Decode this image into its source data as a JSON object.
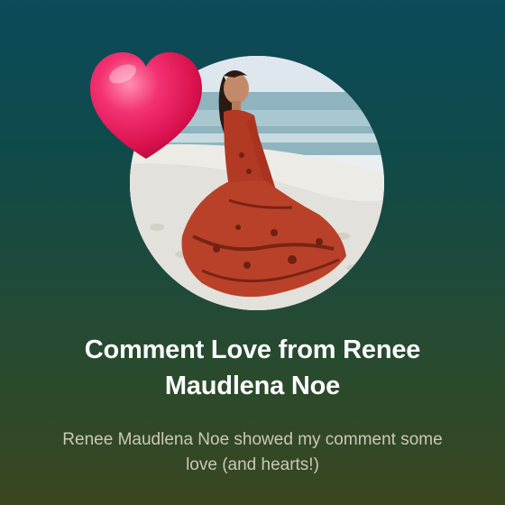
{
  "card": {
    "title": "Comment Love from Renee Maudlena Noe",
    "subtitle": "Renee Maudlena Noe showed my comment some love (and hearts!)"
  },
  "photo": {
    "subject": "woman in red patterned dress twirling on beach"
  },
  "icons": {
    "heart": "heart-icon"
  },
  "colors": {
    "background_top": "#0d4a5a",
    "background_bottom": "#3a4620",
    "heart": "#e8175d",
    "title": "#ffffff",
    "subtitle": "#c9c9b8"
  }
}
